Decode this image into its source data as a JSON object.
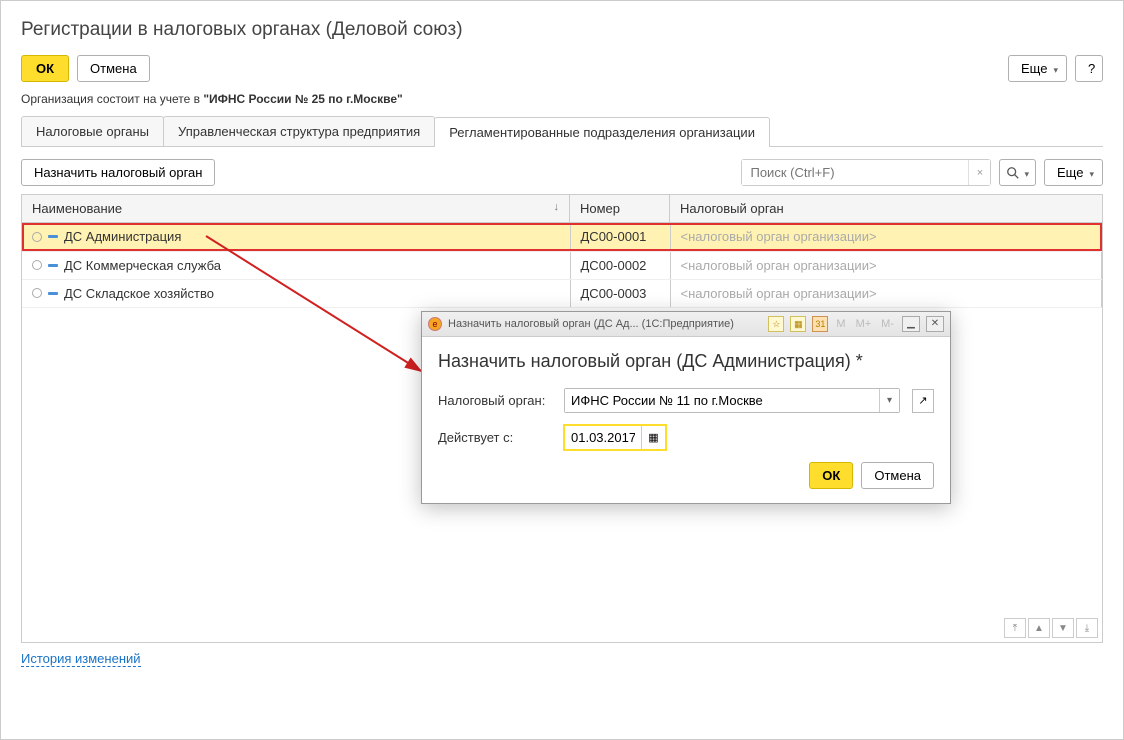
{
  "page_title": "Регистрации в налоговых органах (Деловой союз)",
  "toolbar": {
    "ok": "ОК",
    "cancel": "Отмена",
    "more": "Еще",
    "help": "?"
  },
  "status_prefix": "Организация состоит на учете в ",
  "status_value": "\"ИФНС России № 25 по г.Москве\"",
  "tabs": {
    "t1": "Налоговые органы",
    "t2": "Управленческая структура предприятия",
    "t3": "Регламентированные подразделения организации"
  },
  "subbar": {
    "assign": "Назначить налоговый орган",
    "search_placeholder": "Поиск (Ctrl+F)",
    "more": "Еще"
  },
  "columns": {
    "name": "Наименование",
    "num": "Номер",
    "auth": "Налоговый орган"
  },
  "rows": [
    {
      "name": "ДС Администрация",
      "num": "ДС00-0001",
      "auth": "<налоговый орган организации>"
    },
    {
      "name": "ДС Коммерческая служба",
      "num": "ДС00-0002",
      "auth": "<налоговый орган организации>"
    },
    {
      "name": "ДС Складское хозяйство",
      "num": "ДС00-0003",
      "auth": "<налоговый орган организации>"
    }
  ],
  "history_link": "История изменений",
  "dialog": {
    "titlebar": "Назначить налоговый орган (ДС Ад...  (1С:Предприятие)",
    "heading": "Назначить налоговый орган (ДС Администрация) *",
    "field_auth_label": "Налоговый орган:",
    "field_auth_value": "ИФНС России № 11 по г.Москве",
    "field_date_label": "Действует с:",
    "field_date_value": "01.03.2017",
    "ok": "ОК",
    "cancel": "Отмена",
    "m_labels": {
      "m": "M",
      "mplus": "M+",
      "mminus": "M-"
    }
  }
}
